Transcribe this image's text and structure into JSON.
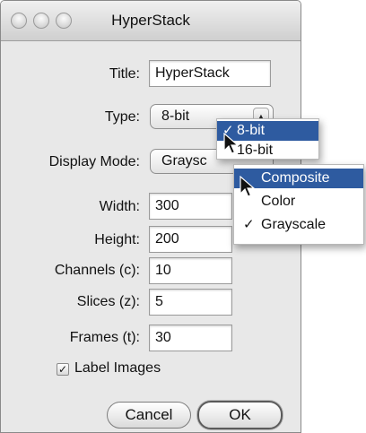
{
  "window": {
    "title": "HyperStack"
  },
  "form": {
    "title_label": "Title:",
    "title_value": "HyperStack",
    "type_label": "Type:",
    "type_value": "8-bit",
    "display_mode_label": "Display Mode:",
    "display_mode_value": "Graysc",
    "width_label": "Width:",
    "width_value": "300",
    "height_label": "Height:",
    "height_value": "200",
    "channels_label": "Channels (c):",
    "channels_value": "10",
    "slices_label": "Slices (z):",
    "slices_value": "5",
    "frames_label": "Frames (t):",
    "frames_value": "30",
    "label_images_label": "Label Images",
    "label_images_checked": true
  },
  "buttons": {
    "cancel": "Cancel",
    "ok": "OK"
  },
  "type_menu": {
    "items": [
      {
        "label": "8-bit",
        "checked": true,
        "selected": true
      },
      {
        "label": "16-bit",
        "checked": false,
        "selected": false
      }
    ]
  },
  "display_menu": {
    "items": [
      {
        "label": "Composite",
        "checked": false,
        "selected": true
      },
      {
        "label": "Color",
        "checked": false,
        "selected": false
      },
      {
        "label": "Grayscale",
        "checked": true,
        "selected": false
      }
    ]
  },
  "symbols": {
    "check": "✓",
    "checkbox_mark": "✓",
    "stepper": "▲▼"
  },
  "colors": {
    "selection": "#2e5ba0",
    "window_bg": "#e8e8e8"
  }
}
